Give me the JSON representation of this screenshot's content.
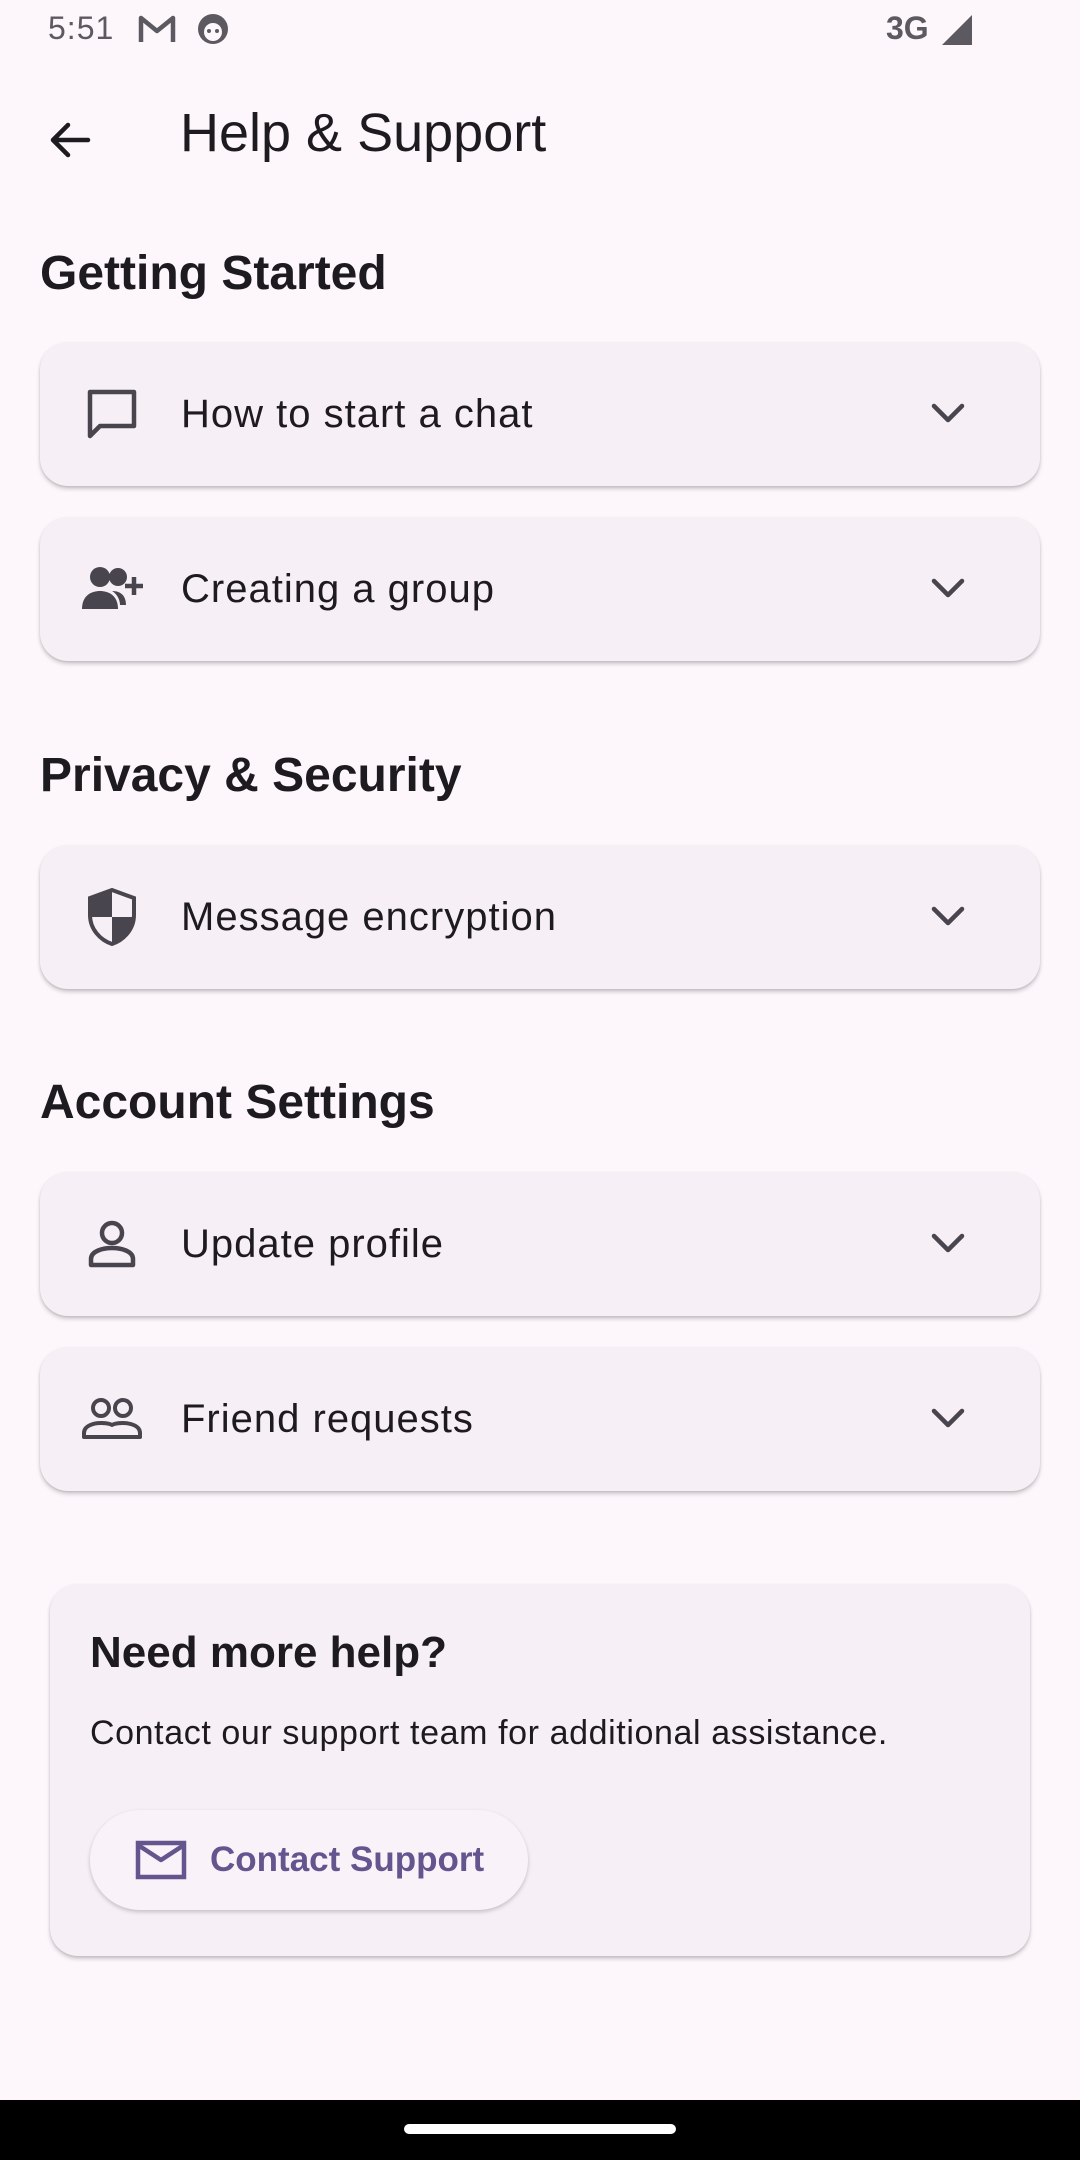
{
  "status_bar": {
    "time": "5:51",
    "network": "3G",
    "icons": [
      "gmail-icon",
      "android-face-icon",
      "signal-icon"
    ]
  },
  "app_bar": {
    "title": "Help & Support",
    "back_icon": "arrow-back-icon"
  },
  "sections": [
    {
      "title": "Getting Started",
      "items": [
        {
          "label": "How to start a chat",
          "icon": "chat-bubble-icon"
        },
        {
          "label": "Creating a group",
          "icon": "group-add-icon"
        }
      ]
    },
    {
      "title": "Privacy & Security",
      "items": [
        {
          "label": "Message encryption",
          "icon": "shield-icon"
        }
      ]
    },
    {
      "title": "Account Settings",
      "items": [
        {
          "label": "Update profile",
          "icon": "person-icon"
        },
        {
          "label": "Friend requests",
          "icon": "people-icon"
        }
      ]
    }
  ],
  "help_card": {
    "title": "Need more help?",
    "text": "Contact our support team for additional assistance.",
    "button_label": "Contact Support",
    "button_icon": "mail-icon"
  },
  "colors": {
    "background": "#fdf7fc",
    "card": "#f6eff6",
    "accent": "#65558f",
    "text": "#1d1b20",
    "icon": "#49454f"
  }
}
